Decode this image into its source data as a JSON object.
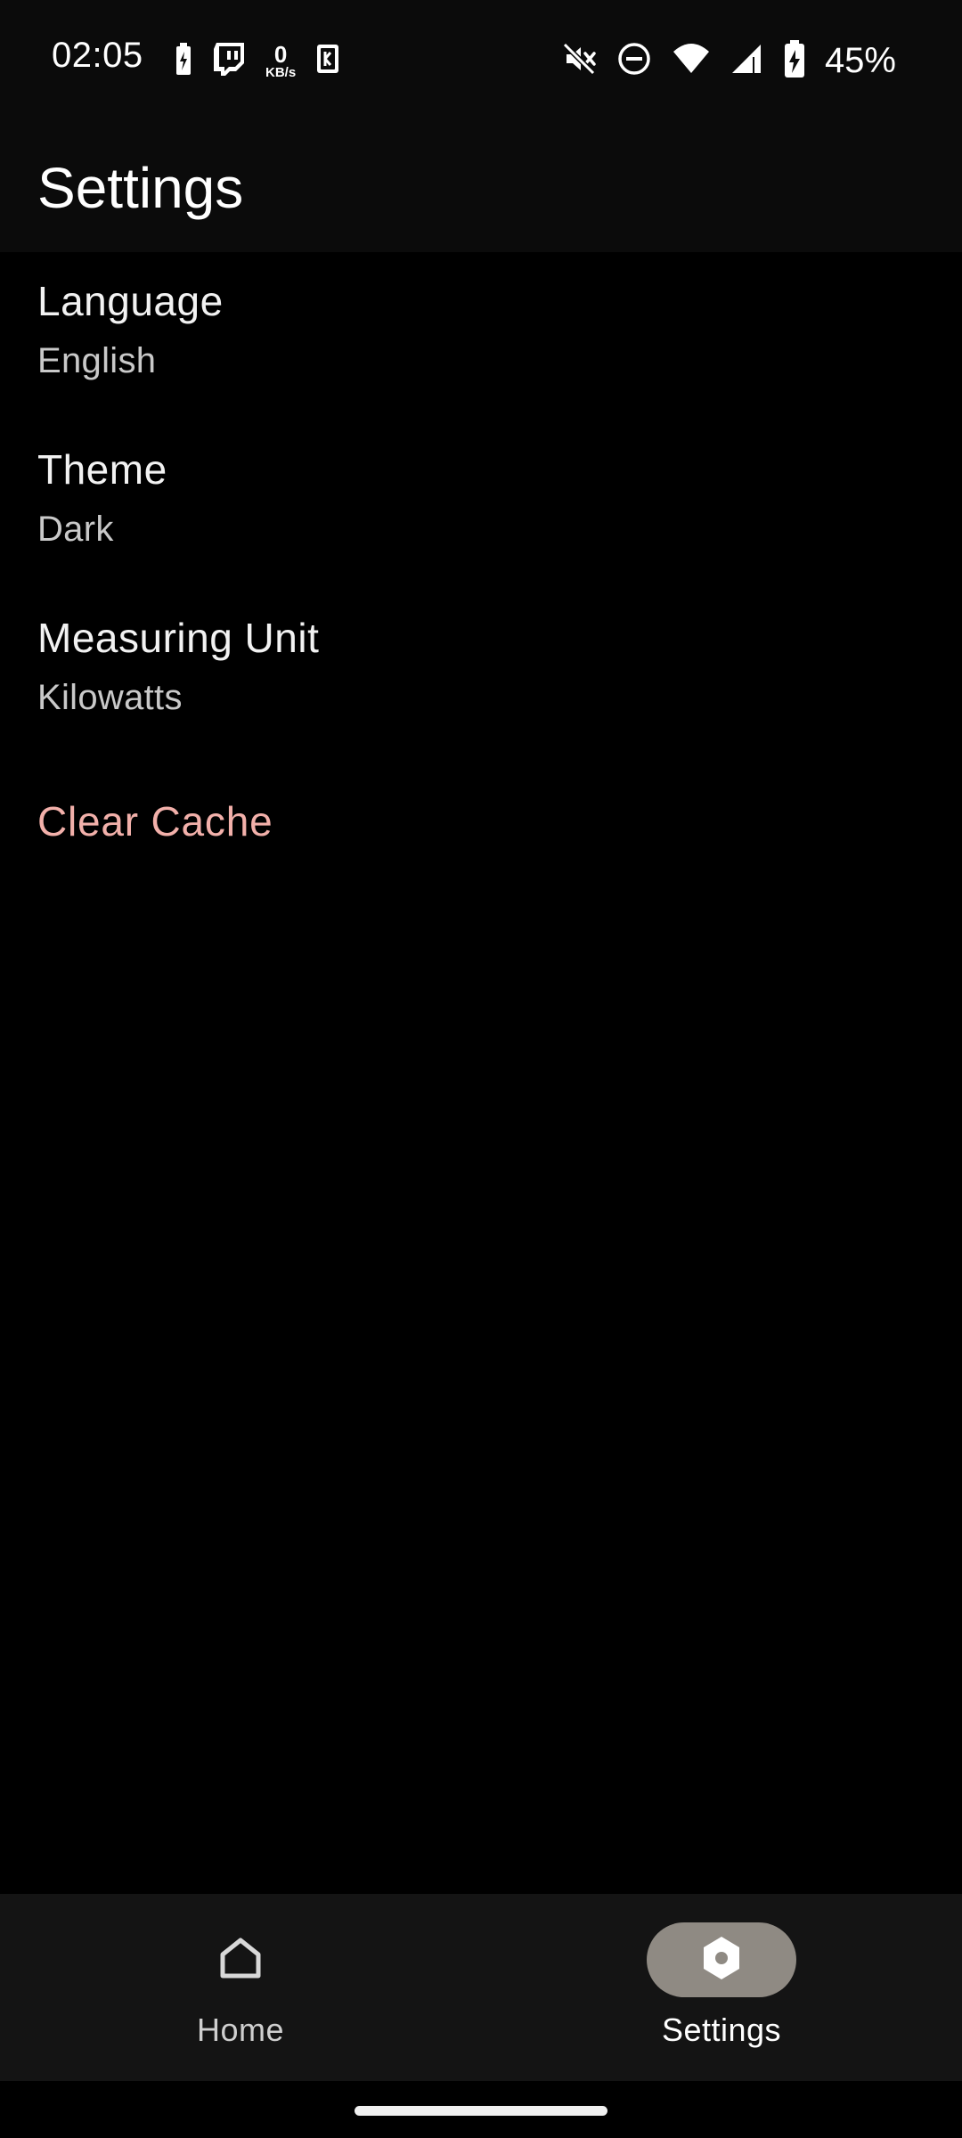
{
  "status_bar": {
    "time": "02:05",
    "netspeed_value": "0",
    "netspeed_unit": "KB/s",
    "battery_percent": "45%"
  },
  "app_bar": {
    "title": "Settings"
  },
  "settings": [
    {
      "title": "Language",
      "value": "English"
    },
    {
      "title": "Theme",
      "value": "Dark"
    },
    {
      "title": "Measuring Unit",
      "value": "Kilowatts"
    }
  ],
  "clear_cache": {
    "label": "Clear Cache",
    "color": "#f2b0aa"
  },
  "bottom_nav": {
    "items": [
      {
        "label": "Home",
        "icon": "home-icon",
        "selected": false
      },
      {
        "label": "Settings",
        "icon": "settings-hexagon-icon",
        "selected": true
      }
    ],
    "selected_pill_color": "#8f8a83"
  }
}
